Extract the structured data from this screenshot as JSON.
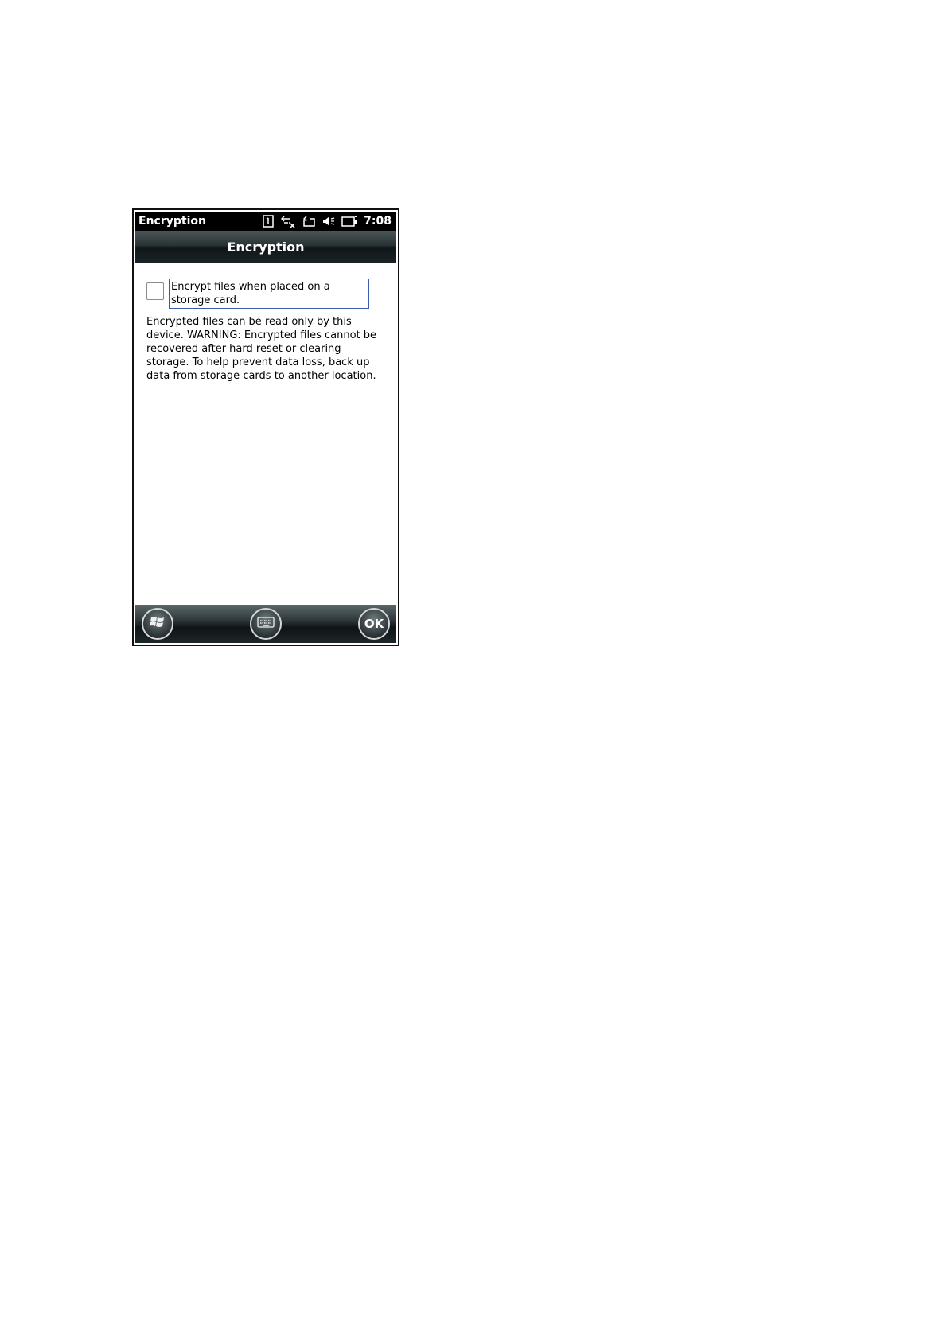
{
  "status_bar": {
    "title": "Encryption",
    "time": "7:08",
    "icons": [
      "sim-card-icon",
      "sync-disconnected-icon",
      "rotate-icon",
      "speaker-muted-icon",
      "battery-icon"
    ]
  },
  "title_bar": {
    "title": "Encryption"
  },
  "settings": {
    "encrypt_checkbox_label": "Encrypt files when placed on a storage card.",
    "encrypt_checked": false,
    "description": "Encrypted files can be read only by this device. WARNING: Encrypted files cannot be recovered after hard reset or clearing storage. To help prevent data loss, back up data from storage cards to another location."
  },
  "bottom_bar": {
    "start_icon": "windows-start-icon",
    "keyboard_icon": "keyboard-icon",
    "ok_label": "OK"
  }
}
